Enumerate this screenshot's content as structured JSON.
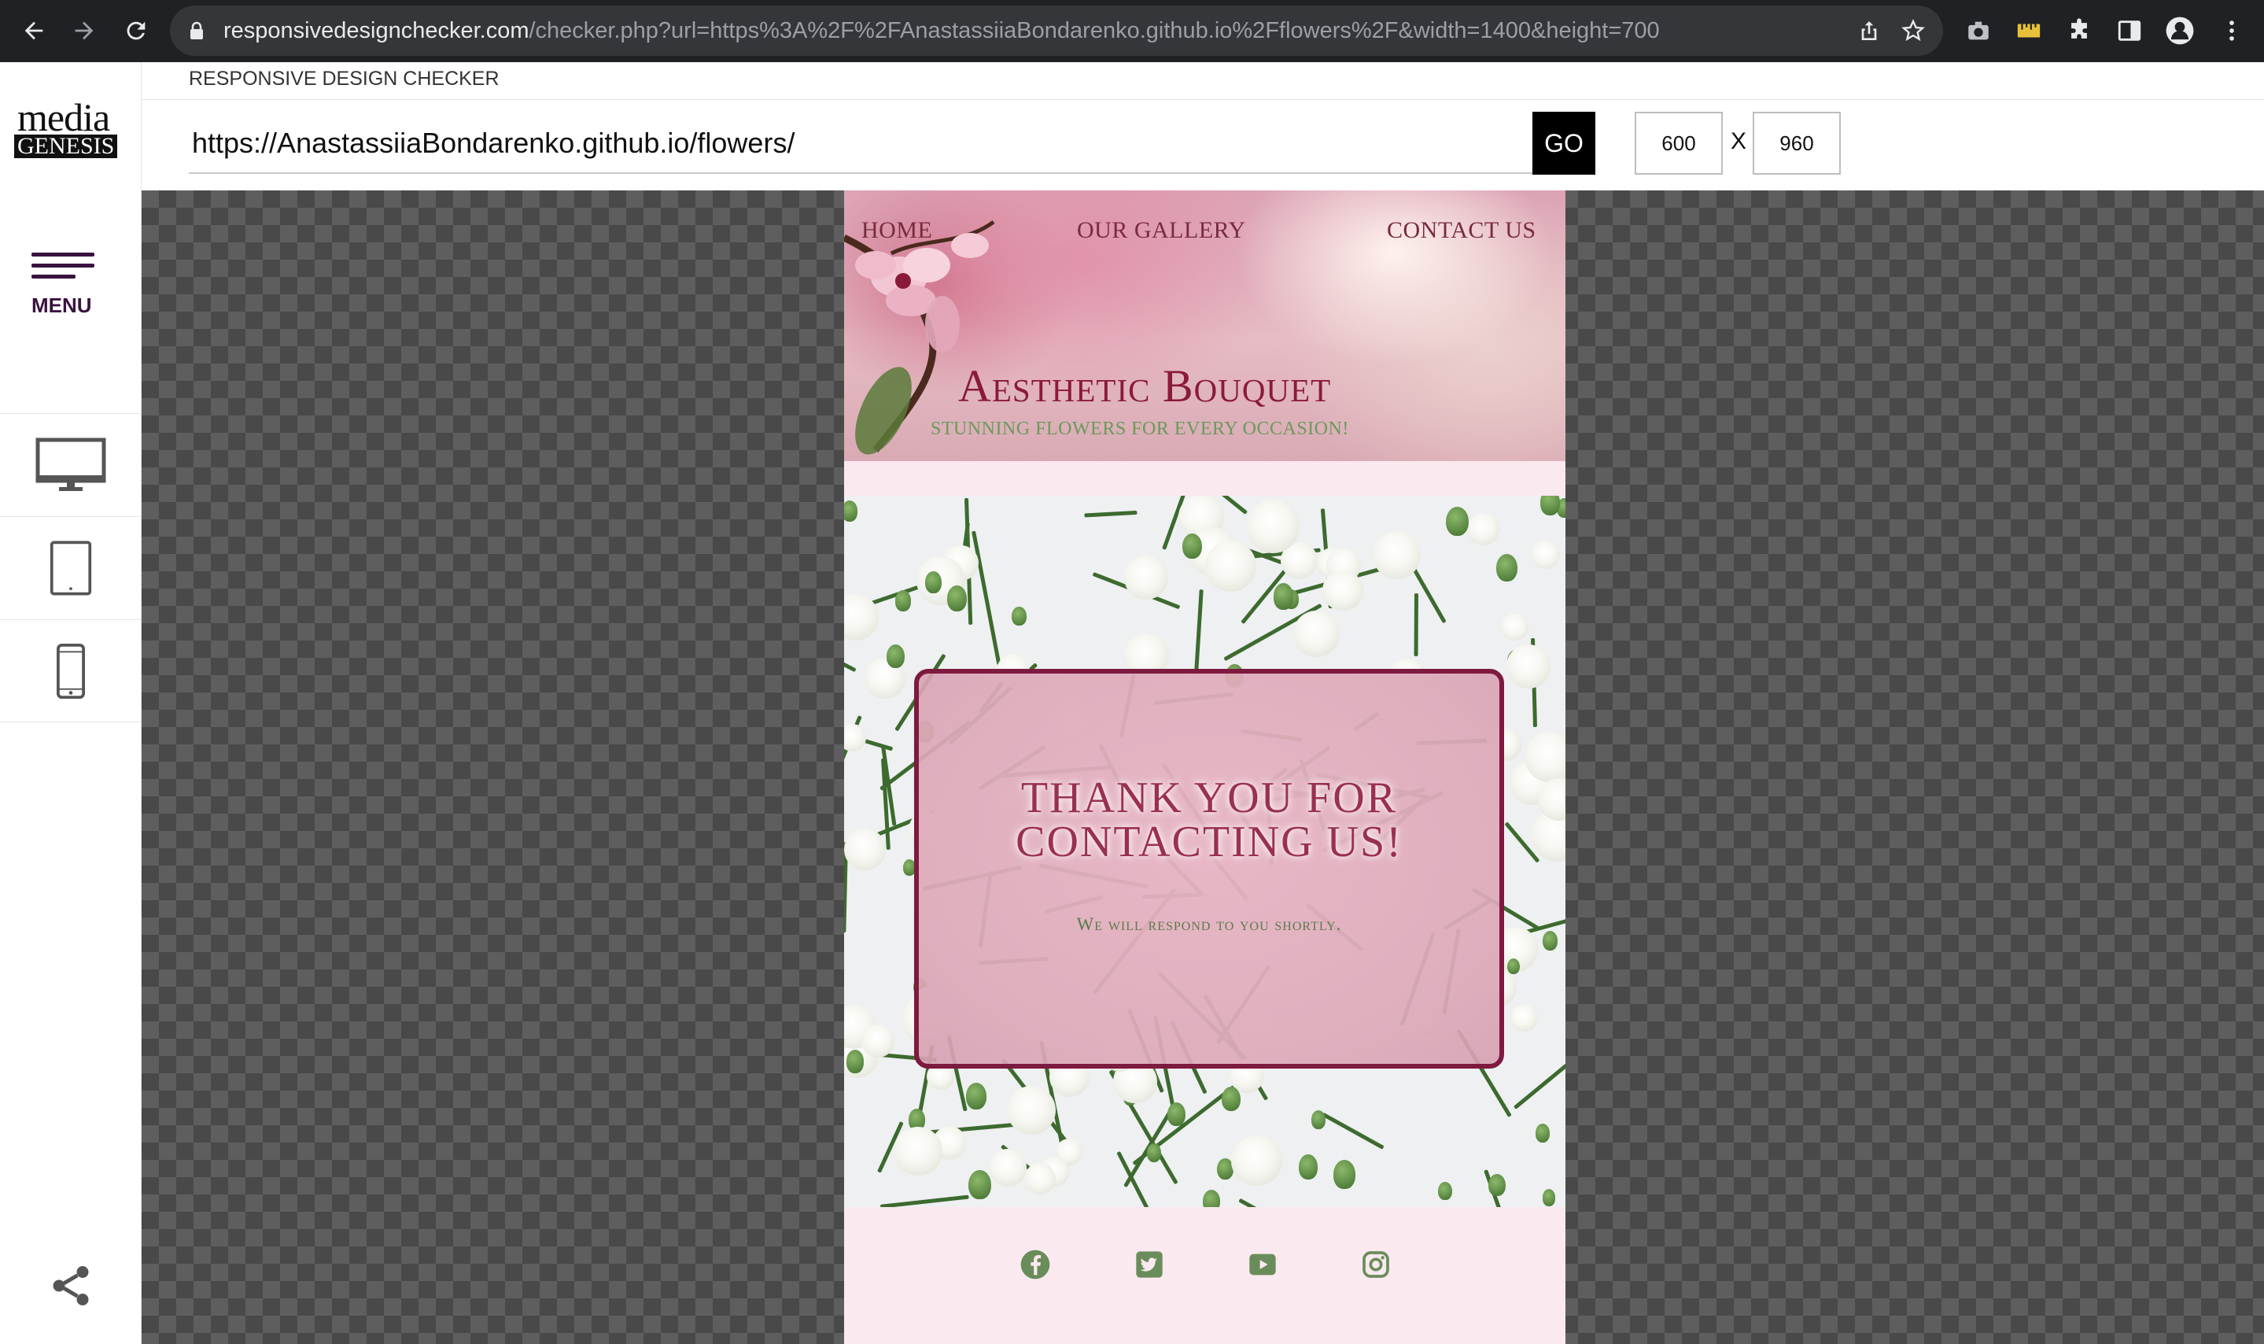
{
  "browser": {
    "url_host": "responsivedesignchecker.com",
    "url_path": "/checker.php?url=https%3A%2F%2FAnastassiiaBondarenko.github.io%2Fflowers%2F&width=1400&height=700"
  },
  "sidebar": {
    "logo_top": "media",
    "logo_bottom": "GENESIS",
    "menu_label": "MENU"
  },
  "checker": {
    "title": "RESPONSIVE DESIGN CHECKER",
    "url_value": "https://AnastassiiaBondarenko.github.io/flowers/",
    "go_label": "GO",
    "width_value": "600",
    "height_value": "960",
    "x_label": "X"
  },
  "site": {
    "nav": [
      "HOME",
      "OUR GALLERY",
      "CONTACT US"
    ],
    "brand": "Aesthetic Bouquet",
    "tagline": "Stunning flowers for every occasion!",
    "card_title_line1": "Thank you for",
    "card_title_line2": "contacting us!",
    "card_subtitle": "We will respond to you shortly.",
    "social_icons": [
      "facebook-icon",
      "twitter-icon",
      "youtube-icon",
      "instagram-icon"
    ]
  },
  "colors": {
    "chrome_bg": "#202124",
    "accent_burgundy": "#7d1a3f",
    "site_bg": "#fbe9f0",
    "footer_icon_green": "#6a8c5a"
  }
}
